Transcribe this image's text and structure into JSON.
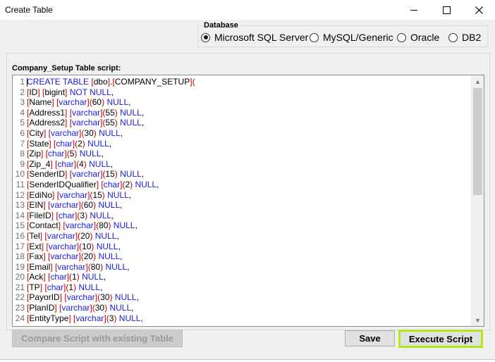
{
  "window": {
    "title": "Create Table",
    "controls": {
      "minimize": "minimize-icon",
      "maximize": "maximize-icon",
      "close": "close-icon"
    }
  },
  "database": {
    "label": "Database",
    "options": [
      {
        "label": "Microsoft SQL Server",
        "checked": true
      },
      {
        "label": "MySQL/Generic",
        "checked": false
      },
      {
        "label": "Oracle",
        "checked": false
      },
      {
        "label": "DB2",
        "checked": false
      }
    ]
  },
  "script": {
    "label": "Company_Setup Table script:",
    "lines": [
      {
        "num": "1",
        "tokens": [
          [
            "k",
            "CREATE TABLE "
          ],
          [
            "p",
            "["
          ],
          [
            "g",
            "dbo"
          ],
          [
            "p",
            "]"
          ],
          [
            "g",
            "."
          ],
          [
            "p",
            "["
          ],
          [
            "g",
            "COMPANY_SETUP"
          ],
          [
            "p",
            "]("
          ]
        ]
      },
      {
        "num": "2",
        "tokens": [
          [
            "p",
            "["
          ],
          [
            "g",
            "ID"
          ],
          [
            "p",
            "] ["
          ],
          [
            "g",
            "bigint"
          ],
          [
            "p",
            "] "
          ],
          [
            "k",
            "NOT NULL"
          ],
          [
            "g",
            ","
          ]
        ]
      },
      {
        "num": "3",
        "tokens": [
          [
            "p",
            "["
          ],
          [
            "g",
            "Name"
          ],
          [
            "p",
            "] ["
          ],
          [
            "k",
            "varchar"
          ],
          [
            "p",
            "]("
          ],
          [
            "g",
            "60"
          ],
          [
            "p",
            ") "
          ],
          [
            "k",
            "NULL"
          ],
          [
            "g",
            ","
          ]
        ]
      },
      {
        "num": "4",
        "tokens": [
          [
            "p",
            "["
          ],
          [
            "g",
            "Address1"
          ],
          [
            "p",
            "] ["
          ],
          [
            "k",
            "varchar"
          ],
          [
            "p",
            "]("
          ],
          [
            "g",
            "55"
          ],
          [
            "p",
            ") "
          ],
          [
            "k",
            "NULL"
          ],
          [
            "g",
            ","
          ]
        ]
      },
      {
        "num": "5",
        "tokens": [
          [
            "p",
            "["
          ],
          [
            "g",
            "Address2"
          ],
          [
            "p",
            "] ["
          ],
          [
            "k",
            "varchar"
          ],
          [
            "p",
            "]("
          ],
          [
            "g",
            "55"
          ],
          [
            "p",
            ") "
          ],
          [
            "k",
            "NULL"
          ],
          [
            "g",
            ","
          ]
        ]
      },
      {
        "num": "6",
        "tokens": [
          [
            "p",
            "["
          ],
          [
            "g",
            "City"
          ],
          [
            "p",
            "] ["
          ],
          [
            "k",
            "varchar"
          ],
          [
            "p",
            "]("
          ],
          [
            "g",
            "30"
          ],
          [
            "p",
            ") "
          ],
          [
            "k",
            "NULL"
          ],
          [
            "g",
            ","
          ]
        ]
      },
      {
        "num": "7",
        "tokens": [
          [
            "p",
            "["
          ],
          [
            "g",
            "State"
          ],
          [
            "p",
            "] ["
          ],
          [
            "k",
            "char"
          ],
          [
            "p",
            "]("
          ],
          [
            "g",
            "2"
          ],
          [
            "p",
            ") "
          ],
          [
            "k",
            "NULL"
          ],
          [
            "g",
            ","
          ]
        ]
      },
      {
        "num": "8",
        "tokens": [
          [
            "p",
            "["
          ],
          [
            "g",
            "Zip"
          ],
          [
            "p",
            "] ["
          ],
          [
            "k",
            "char"
          ],
          [
            "p",
            "]("
          ],
          [
            "g",
            "5"
          ],
          [
            "p",
            ") "
          ],
          [
            "k",
            "NULL"
          ],
          [
            "g",
            ","
          ]
        ]
      },
      {
        "num": "9",
        "tokens": [
          [
            "p",
            "["
          ],
          [
            "g",
            "Zip_4"
          ],
          [
            "p",
            "] ["
          ],
          [
            "k",
            "char"
          ],
          [
            "p",
            "]("
          ],
          [
            "g",
            "4"
          ],
          [
            "p",
            ") "
          ],
          [
            "k",
            "NULL"
          ],
          [
            "g",
            ","
          ]
        ]
      },
      {
        "num": "10",
        "tokens": [
          [
            "p",
            "["
          ],
          [
            "g",
            "SenderID"
          ],
          [
            "p",
            "] ["
          ],
          [
            "k",
            "varchar"
          ],
          [
            "p",
            "]("
          ],
          [
            "g",
            "15"
          ],
          [
            "p",
            ") "
          ],
          [
            "k",
            "NULL"
          ],
          [
            "g",
            ","
          ]
        ]
      },
      {
        "num": "11",
        "tokens": [
          [
            "p",
            "["
          ],
          [
            "g",
            "SenderIDQualifier"
          ],
          [
            "p",
            "] ["
          ],
          [
            "k",
            "char"
          ],
          [
            "p",
            "]("
          ],
          [
            "g",
            "2"
          ],
          [
            "p",
            ") "
          ],
          [
            "k",
            "NULL"
          ],
          [
            "g",
            ","
          ]
        ]
      },
      {
        "num": "12",
        "tokens": [
          [
            "p",
            "["
          ],
          [
            "g",
            "EdiNo"
          ],
          [
            "p",
            "] ["
          ],
          [
            "k",
            "varchar"
          ],
          [
            "p",
            "]("
          ],
          [
            "g",
            "15"
          ],
          [
            "p",
            ") "
          ],
          [
            "k",
            "NULL"
          ],
          [
            "g",
            ","
          ]
        ]
      },
      {
        "num": "13",
        "tokens": [
          [
            "p",
            "["
          ],
          [
            "g",
            "EIN"
          ],
          [
            "p",
            "] ["
          ],
          [
            "k",
            "varchar"
          ],
          [
            "p",
            "]("
          ],
          [
            "g",
            "60"
          ],
          [
            "p",
            ") "
          ],
          [
            "k",
            "NULL"
          ],
          [
            "g",
            ","
          ]
        ]
      },
      {
        "num": "14",
        "tokens": [
          [
            "p",
            "["
          ],
          [
            "g",
            "FileID"
          ],
          [
            "p",
            "] ["
          ],
          [
            "k",
            "char"
          ],
          [
            "p",
            "]("
          ],
          [
            "g",
            "3"
          ],
          [
            "p",
            ") "
          ],
          [
            "k",
            "NULL"
          ],
          [
            "g",
            ","
          ]
        ]
      },
      {
        "num": "15",
        "tokens": [
          [
            "p",
            "["
          ],
          [
            "g",
            "Contact"
          ],
          [
            "p",
            "] ["
          ],
          [
            "k",
            "varchar"
          ],
          [
            "p",
            "]("
          ],
          [
            "g",
            "80"
          ],
          [
            "p",
            ") "
          ],
          [
            "k",
            "NULL"
          ],
          [
            "g",
            ","
          ]
        ]
      },
      {
        "num": "16",
        "tokens": [
          [
            "p",
            "["
          ],
          [
            "g",
            "Tel"
          ],
          [
            "p",
            "] ["
          ],
          [
            "k",
            "varchar"
          ],
          [
            "p",
            "]("
          ],
          [
            "g",
            "20"
          ],
          [
            "p",
            ") "
          ],
          [
            "k",
            "NULL"
          ],
          [
            "g",
            ","
          ]
        ]
      },
      {
        "num": "17",
        "tokens": [
          [
            "p",
            "["
          ],
          [
            "g",
            "Ext"
          ],
          [
            "p",
            "] ["
          ],
          [
            "k",
            "varchar"
          ],
          [
            "p",
            "]("
          ],
          [
            "g",
            "10"
          ],
          [
            "p",
            ") "
          ],
          [
            "k",
            "NULL"
          ],
          [
            "g",
            ","
          ]
        ]
      },
      {
        "num": "18",
        "tokens": [
          [
            "p",
            "["
          ],
          [
            "g",
            "Fax"
          ],
          [
            "p",
            "] ["
          ],
          [
            "k",
            "varchar"
          ],
          [
            "p",
            "]("
          ],
          [
            "g",
            "20"
          ],
          [
            "p",
            ") "
          ],
          [
            "k",
            "NULL"
          ],
          [
            "g",
            ","
          ]
        ]
      },
      {
        "num": "19",
        "tokens": [
          [
            "p",
            "["
          ],
          [
            "g",
            "Email"
          ],
          [
            "p",
            "] ["
          ],
          [
            "k",
            "varchar"
          ],
          [
            "p",
            "]("
          ],
          [
            "g",
            "80"
          ],
          [
            "p",
            ") "
          ],
          [
            "k",
            "NULL"
          ],
          [
            "g",
            ","
          ]
        ]
      },
      {
        "num": "20",
        "tokens": [
          [
            "p",
            "["
          ],
          [
            "g",
            "Ack"
          ],
          [
            "p",
            "] ["
          ],
          [
            "k",
            "char"
          ],
          [
            "p",
            "]("
          ],
          [
            "g",
            "1"
          ],
          [
            "p",
            ") "
          ],
          [
            "k",
            "NULL"
          ],
          [
            "g",
            ","
          ]
        ]
      },
      {
        "num": "21",
        "tokens": [
          [
            "p",
            "["
          ],
          [
            "g",
            "TP"
          ],
          [
            "p",
            "] ["
          ],
          [
            "k",
            "char"
          ],
          [
            "p",
            "]("
          ],
          [
            "g",
            "1"
          ],
          [
            "p",
            ") "
          ],
          [
            "k",
            "NULL"
          ],
          [
            "g",
            ","
          ]
        ]
      },
      {
        "num": "22",
        "tokens": [
          [
            "p",
            "["
          ],
          [
            "g",
            "PayorID"
          ],
          [
            "p",
            "] ["
          ],
          [
            "k",
            "varchar"
          ],
          [
            "p",
            "]("
          ],
          [
            "g",
            "30"
          ],
          [
            "p",
            ") "
          ],
          [
            "k",
            "NULL"
          ],
          [
            "g",
            ","
          ]
        ]
      },
      {
        "num": "23",
        "tokens": [
          [
            "p",
            "["
          ],
          [
            "g",
            "PlanID"
          ],
          [
            "p",
            "] ["
          ],
          [
            "k",
            "varchar"
          ],
          [
            "p",
            "]("
          ],
          [
            "g",
            "30"
          ],
          [
            "p",
            ") "
          ],
          [
            "k",
            "NULL"
          ],
          [
            "g",
            ","
          ]
        ]
      },
      {
        "num": "24",
        "tokens": [
          [
            "p",
            "["
          ],
          [
            "g",
            "EntityType"
          ],
          [
            "p",
            "] ["
          ],
          [
            "k",
            "varchar"
          ],
          [
            "p",
            "]("
          ],
          [
            "g",
            "3"
          ],
          [
            "p",
            ") "
          ],
          [
            "k",
            "NULL"
          ],
          [
            "g",
            ","
          ]
        ]
      }
    ],
    "scrollbar": {
      "up_icon": "scroll-up-arrow-icon",
      "down_icon": "scroll-down-arrow-icon"
    }
  },
  "buttons": {
    "compare": "Compare Script with existing Table",
    "save": "Save",
    "execute": "Execute Script"
  },
  "colors": {
    "keyword": "#1a1adf",
    "bracket": "#c00000",
    "identifier": "#000000",
    "highlight": "#b5e61d"
  }
}
